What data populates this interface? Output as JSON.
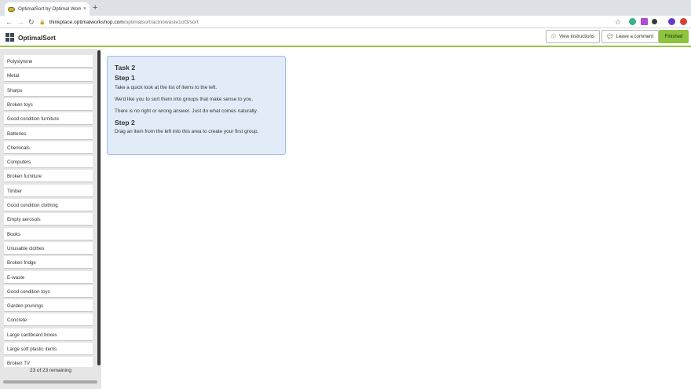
{
  "browser": {
    "tab_title": "OptimalSort by Optimal Worksh",
    "tab_close": "×",
    "new_tab": "+",
    "url_host": "thinkplace.optimalworkshop.com",
    "url_path": "/optimalsort/actnowaste1of3/sort",
    "extension_colors": [
      "#35b28a",
      "#b34ad3",
      "#3a3a3a",
      "#6a3bc2",
      "#d9412f"
    ]
  },
  "header": {
    "app_name": "OptimalSort",
    "view_instructions_label": "View instructions",
    "leave_comment_label": "Leave a comment",
    "finished_label": "Finished",
    "accent_color": "#8cc43e"
  },
  "sidebar": {
    "cards": [
      "Polystyrene",
      "Metal",
      "Sharps",
      "Broken toys",
      "Good condition furniture",
      "Batteries",
      "Chemicals",
      "Computers",
      "Broken furniture",
      "Timber",
      "Good condition clothing",
      "Empty aerosols",
      "Books",
      "Unusable clothes",
      "Broken fridge",
      "E-waste",
      "Good condition toys",
      "Garden prunings",
      "Concrete",
      "Large cardboard boxes",
      "Large soft plastic items",
      "Broken TV"
    ],
    "remaining_text": "23 of 23 remaining"
  },
  "task": {
    "title": "Task 2",
    "step1_heading": "Step 1",
    "step1_lines": [
      "Take a quick look at the list of items to the left.",
      "We'd like you to sort them into groups that make sense to you.",
      "There is no right or wrong answer. Just do what comes naturally."
    ],
    "step2_heading": "Step 2",
    "step2_line": "Drag an item from the left into this area to create your first group."
  }
}
